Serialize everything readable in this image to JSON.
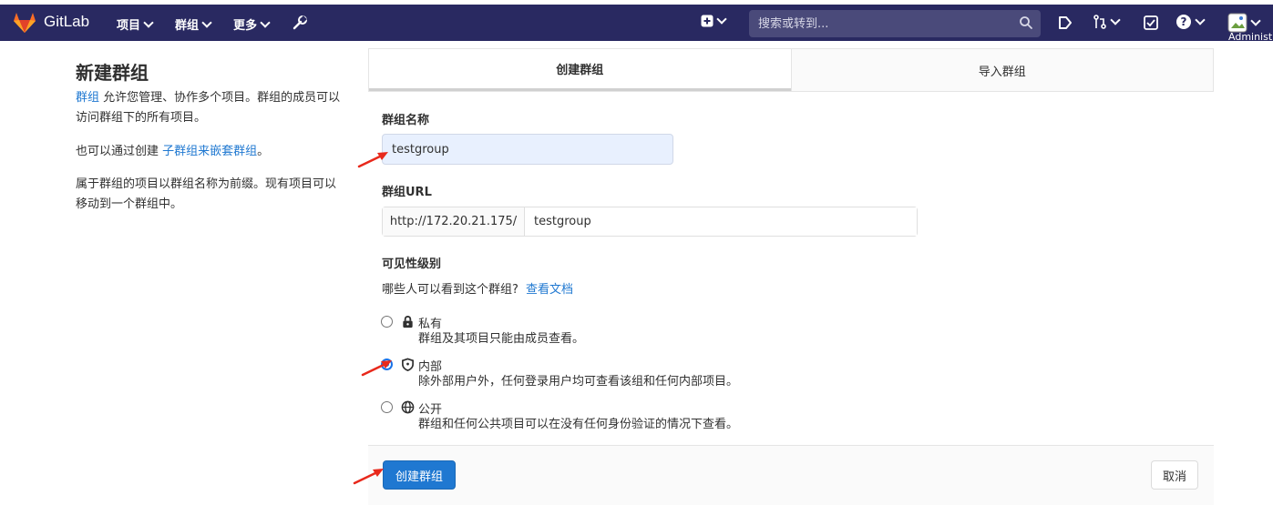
{
  "topbar": {
    "brand": "GitLab",
    "nav": [
      "项目",
      "群组",
      "更多"
    ],
    "search_placeholder": "搜索或转到...",
    "user_label": "Administ"
  },
  "sidebar": {
    "title": "新建群组",
    "p1_link": "群组",
    "p1_text": "允许您管理、协作多个项目。群组的成员可以访问群组下的所有项目。",
    "p2_text": "也可以通过创建",
    "p2_link": "子群组来嵌套群组",
    "p2_end": "。",
    "p3_text": "属于群组的项目以群组名称为前缀。现有项目可以移动到一个群组中。"
  },
  "tabs": {
    "create": "创建群组",
    "import": "导入群组"
  },
  "form": {
    "name_label": "群组名称",
    "name_value": "testgroup",
    "url_label": "群组URL",
    "url_prefix": "http://172.20.21.175/",
    "url_value": "testgroup",
    "visibility_label": "可见性级别",
    "help_text": "哪些人可以看到这个群组?",
    "help_link": "查看文档",
    "options": [
      {
        "title": "私有",
        "desc": "群组及其项目只能由成员查看。"
      },
      {
        "title": "内部",
        "desc": "除外部用户外，任何登录用户均可查看该组和任何内部项目。"
      },
      {
        "title": "公开",
        "desc": "群组和任何公共项目可以在没有任何身份验证的情况下查看。"
      }
    ],
    "selected_option": "内部",
    "create_button": "创建群组",
    "cancel_button": "取消"
  },
  "colors": {
    "topbar": "#292961",
    "primary": "#1f78d1",
    "annotation": "#e8291c"
  }
}
